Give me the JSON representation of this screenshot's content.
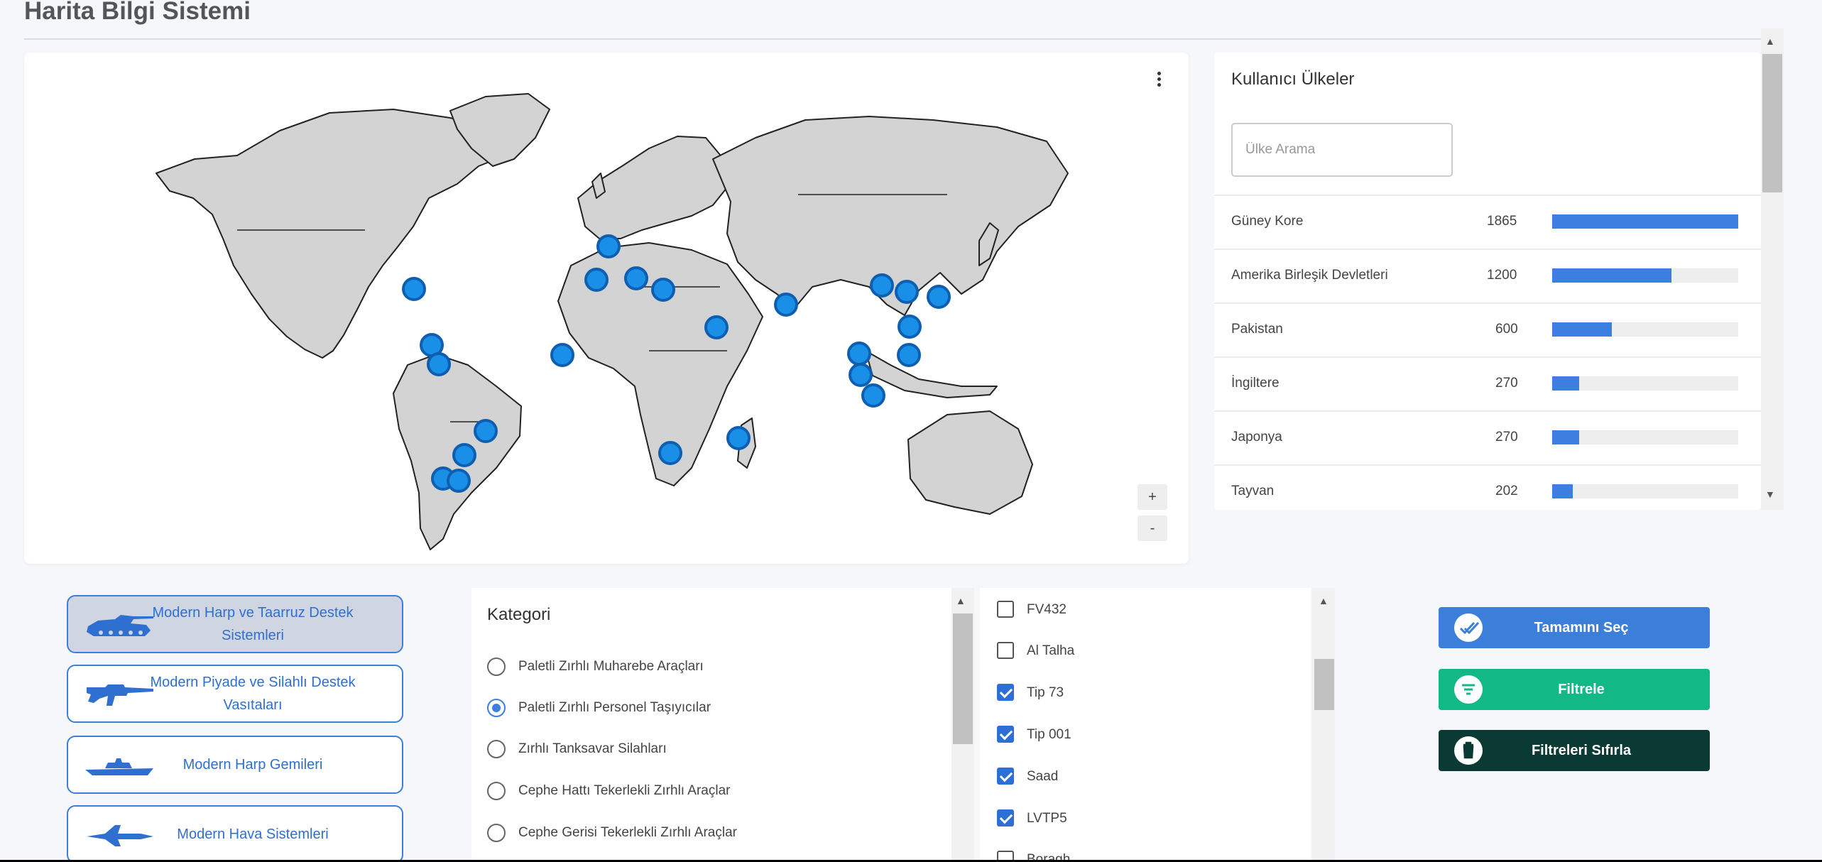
{
  "page": {
    "title": "Harita Bilgi Sistemi"
  },
  "map": {
    "zoom_in_label": "+",
    "zoom_out_label": "-",
    "marker_color": "#1a8fe8",
    "land_color": "#d3d3d3"
  },
  "countries": {
    "title": "Kullanıcı Ülkeler",
    "search_placeholder": "Ülke Arama",
    "bar_color": "#3d7fe0",
    "items": [
      {
        "name": "Güney Kore",
        "count": "1865",
        "share": 1.0
      },
      {
        "name": "Amerika Birleşik Devletleri",
        "count": "1200",
        "share": 0.64
      },
      {
        "name": "Pakistan",
        "count": "600",
        "share": 0.32
      },
      {
        "name": "İngiltere",
        "count": "270",
        "share": 0.145
      },
      {
        "name": "Japonya",
        "count": "270",
        "share": 0.145
      },
      {
        "name": "Tayvan",
        "count": "202",
        "share": 0.11
      }
    ]
  },
  "categories": {
    "items": [
      {
        "label": "Modern Harp ve Taarruz Destek Sistemleri",
        "icon": "tank-icon",
        "active": true
      },
      {
        "label": "Modern Piyade ve Silahlı Destek Vasıtaları",
        "icon": "rifle-icon",
        "active": false
      },
      {
        "label": "Modern Harp Gemileri",
        "icon": "warship-icon",
        "active": false
      },
      {
        "label": "Modern Hava Sistemleri",
        "icon": "jet-icon",
        "active": false
      }
    ]
  },
  "kategori": {
    "title": "Kategori",
    "options": [
      {
        "label": "Paletli Zırhlı Muharebe Araçları",
        "checked": false
      },
      {
        "label": "Paletli Zırhlı Personel Taşıyıcılar",
        "checked": true
      },
      {
        "label": "Zırhlı Tanksavar Silahları",
        "checked": false
      },
      {
        "label": "Cephe Hattı Tekerlekli Zırhlı Araçlar",
        "checked": false
      },
      {
        "label": "Cephe Gerisi Tekerlekli Zırhlı Araçlar",
        "checked": false
      }
    ]
  },
  "models": {
    "items": [
      {
        "label": "FV432",
        "checked": false
      },
      {
        "label": "Al Talha",
        "checked": false
      },
      {
        "label": "Tip 73",
        "checked": true
      },
      {
        "label": "Tip 001",
        "checked": true
      },
      {
        "label": "Saad",
        "checked": true
      },
      {
        "label": "LVTP5",
        "checked": true
      },
      {
        "label": "Boragh",
        "checked": false
      }
    ]
  },
  "actions": {
    "select_all": {
      "label": "Tamamını Seç",
      "color": "#3b7fdb",
      "icon": "double-check-icon"
    },
    "filter": {
      "label": "Filtrele",
      "color": "#12b886",
      "icon": "filter-icon"
    },
    "reset": {
      "label": "Filtreleri Sıfırla",
      "color": "#0b3a35",
      "icon": "trash-icon"
    }
  }
}
